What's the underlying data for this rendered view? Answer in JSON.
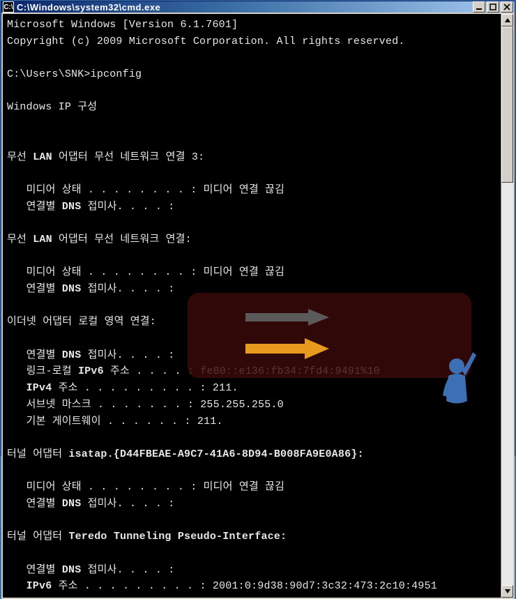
{
  "window": {
    "title": "C:\\Windows\\system32\\cmd.exe"
  },
  "console": {
    "l01": "Microsoft Windows [Version 6.1.7601]",
    "l02": "Copyright (c) 2009 Microsoft Corporation. All rights reserved.",
    "l03": "",
    "l04": "C:\\Users\\SNK>ipconfig",
    "l05": "",
    "l06": "Windows IP 구성",
    "l07": "",
    "l08": "",
    "l09a": "무선 ",
    "l09b": "LAN",
    "l09c": " 어댑터 무선 네트워크 연결 3:",
    "l10": "",
    "l11": "   미디어 상태 . . . . . . . . : 미디어 연결 끊김",
    "l12a": "   연결별 ",
    "l12b": "DNS",
    "l12c": " 접미사. . . . :",
    "l13": "",
    "l14a": "무선 ",
    "l14b": "LAN",
    "l14c": " 어댑터 무선 네트워크 연결:",
    "l15": "",
    "l16": "   미디어 상태 . . . . . . . . : 미디어 연결 끊김",
    "l17a": "   연결별 ",
    "l17b": "DNS",
    "l17c": " 접미사. . . . :",
    "l18": "",
    "l19": "이더넷 어댑터 로컬 영역 연결:",
    "l20": "",
    "l21a": "   연결별 ",
    "l21b": "DNS",
    "l21c": " 접미사. . . . :",
    "l22a": "   링크-로컬 ",
    "l22b": "IPv6",
    "l22c": " 주소 . . . . : fe80::e136:fb34:7fd4:9491%10",
    "l23a": "   ",
    "l23b": "IPv4",
    "l23c": " 주소 . . . . . . . . . : 211.",
    "l24": "   서브넷 마스크 . . . . . . . : 255.255.255.0",
    "l25": "   기본 게이트웨이 . . . . . . : 211.",
    "l26": "",
    "l27a": "터널 어댑터 ",
    "l27b": "isatap.{D44FBEAE-A9C7-41A6-8D94-B008FA9E0A86}:",
    "l28": "",
    "l29": "   미디어 상태 . . . . . . . . : 미디어 연결 끊김",
    "l30a": "   연결별 ",
    "l30b": "DNS",
    "l30c": " 접미사. . . . :",
    "l31": "",
    "l32a": "터널 어댑터 ",
    "l32b": "Teredo Tunneling Pseudo-Interface:",
    "l33": "",
    "l34a": "   연결별 ",
    "l34b": "DNS",
    "l34c": " 접미사. . . . :",
    "l35a": "   ",
    "l35b": "IPv6",
    "l35c": " 주소 . . . . . . . . . : 2001:0:9d38:90d7:3c32:473:2c10:4951"
  },
  "colors": {
    "highlight_bg": "rgba(60,10,10,0.82)",
    "arrow_orange": "#e89a1e",
    "arrow_gray": "#5a5a5a",
    "person": "#3c6fb3"
  }
}
